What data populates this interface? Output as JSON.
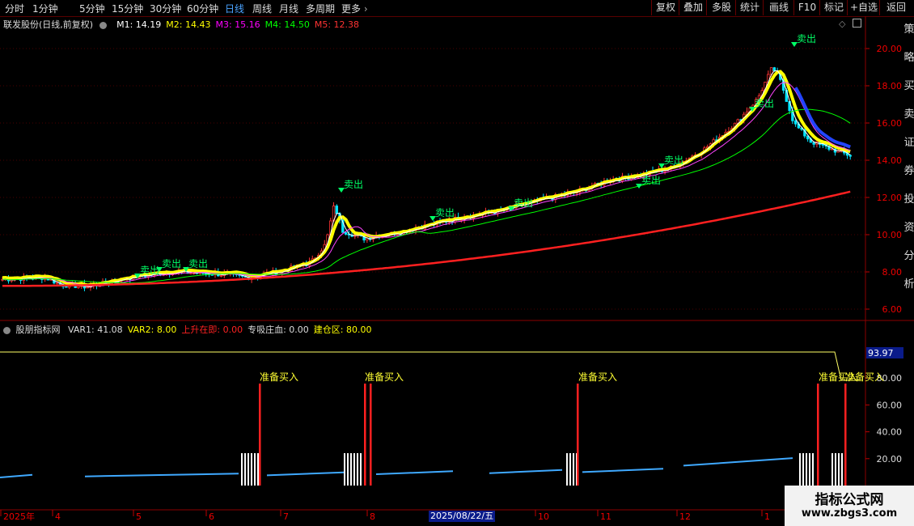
{
  "toolbar": {
    "periods": [
      "分时",
      "1分钟",
      "5分钟",
      "15分钟",
      "30分钟",
      "60分钟",
      "日线",
      "周线",
      "月线",
      "多周期",
      "更多"
    ],
    "active_period": "日线",
    "right_buttons": [
      "复权",
      "叠加",
      "多股",
      "统计",
      "画线",
      "F10",
      "标记",
      "+自选",
      "返回"
    ]
  },
  "main_panel": {
    "stock_title": "联发股份(日线,前复权)",
    "ma_labels": [
      {
        "text": "M1: 14.19",
        "color": "#ffffff"
      },
      {
        "text": "M2: 14.43",
        "color": "#ffff00"
      },
      {
        "text": "M3: 15.16",
        "color": "#ff00ff"
      },
      {
        "text": "M4: 14.50",
        "color": "#00ff00"
      },
      {
        "text": "M5: 12.38",
        "color": "#ff3333"
      }
    ],
    "price_ticks": [
      "20.00",
      "18.00",
      "16.00",
      "14.00",
      "12.00",
      "10.00",
      "8.00",
      "6.00"
    ],
    "sell_label": "卖出",
    "sell_markers": 9
  },
  "indicator_panel": {
    "title": "股朋指标网",
    "values": [
      {
        "text": "VAR1: 41.08",
        "color": "#dddddd"
      },
      {
        "text": "VAR2: 8.00",
        "color": "#ffff00"
      },
      {
        "text": "上升在即: 0.00",
        "color": "#ff2222"
      },
      {
        "text": "专吸庄血: 0.00",
        "color": "#dddddd"
      },
      {
        "text": "建仓区: 80.00",
        "color": "#ffff00"
      }
    ],
    "ticks": [
      "80.00",
      "60.00",
      "40.00",
      "20.00"
    ],
    "current_value": "93.97",
    "buy_label": "准备买入"
  },
  "time_axis": {
    "labels": [
      "2025年",
      "4",
      "5",
      "6",
      "7",
      "8",
      "10",
      "11",
      "12",
      "1"
    ],
    "cursor_date": "2025/08/22/五"
  },
  "right_strip": {
    "text": "策略买卖证券投资分析"
  },
  "watermark": {
    "line1": "指标公式网",
    "line2": "www.zbgs3.com"
  }
}
